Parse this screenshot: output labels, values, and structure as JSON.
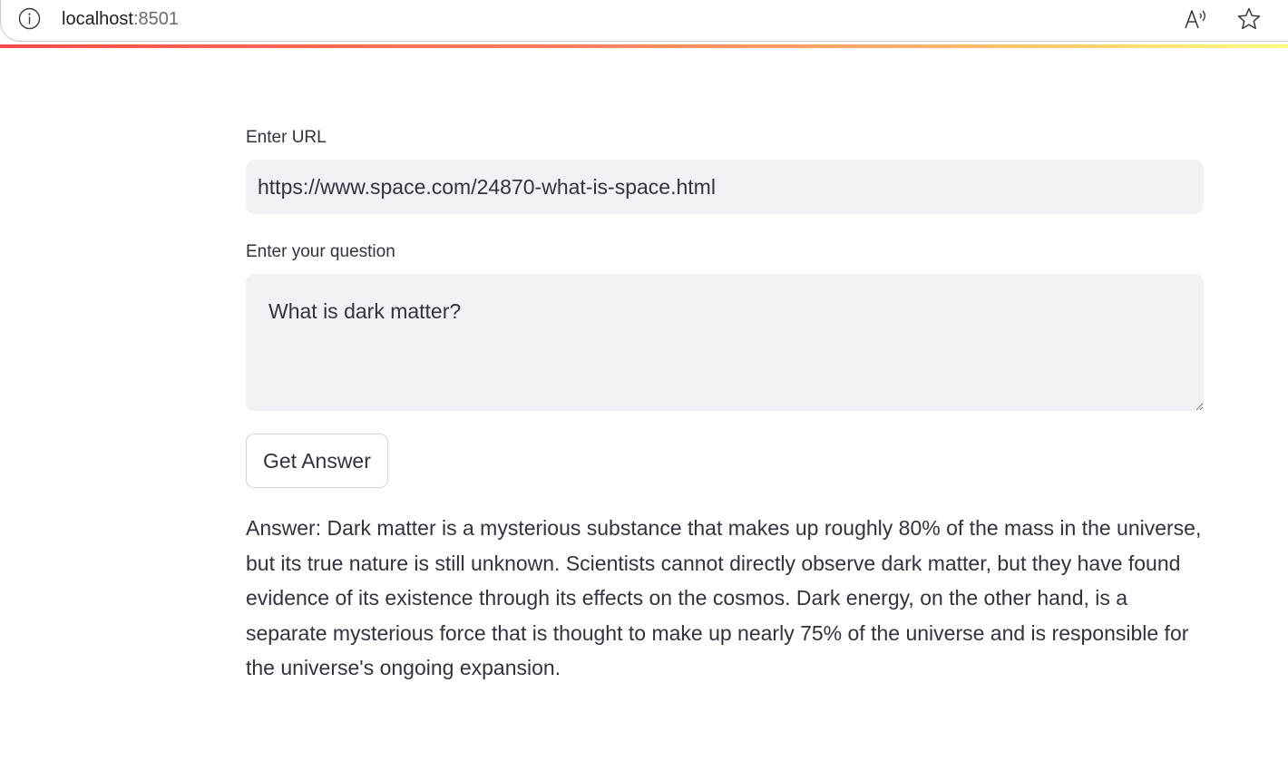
{
  "browser": {
    "host": "localhost",
    "port": ":8501",
    "icons": [
      "info-icon",
      "read-aloud-icon",
      "star-icon"
    ]
  },
  "form": {
    "url_label": "Enter URL",
    "url_value": "https://www.space.com/24870-what-is-space.html",
    "question_label": "Enter your question",
    "question_value": "What is dark matter?",
    "submit_label": "Get Answer"
  },
  "answer": {
    "text": "Answer: Dark matter is a mysterious substance that makes up roughly 80% of the mass in the universe, but its true nature is still unknown. Scientists cannot directly observe dark matter, but they have found evidence of its existence through its effects on the cosmos. Dark energy, on the other hand, is a separate mysterious force that is thought to make up nearly 75% of the universe and is responsible for the universe's ongoing expansion."
  },
  "colors": {
    "text": "#31333f",
    "input_bg": "#f0f2f6",
    "accent_start": "#ff4b4b",
    "accent_end": "#fffd80"
  }
}
